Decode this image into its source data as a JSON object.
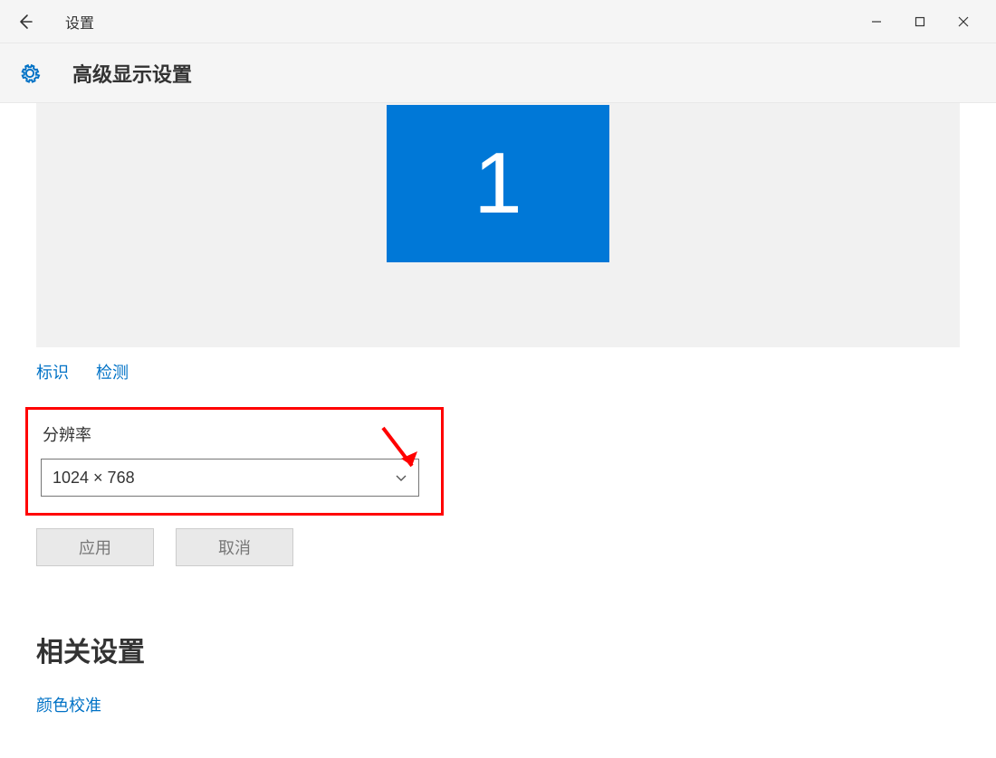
{
  "window": {
    "app_name": "设置"
  },
  "page": {
    "title": "高级显示设置"
  },
  "monitor": {
    "number": "1"
  },
  "links": {
    "identify": "标识",
    "detect": "检测"
  },
  "resolution": {
    "label": "分辨率",
    "value": "1024 × 768"
  },
  "buttons": {
    "apply": "应用",
    "cancel": "取消"
  },
  "related": {
    "heading": "相关设置",
    "color_calibration": "颜色校准"
  }
}
